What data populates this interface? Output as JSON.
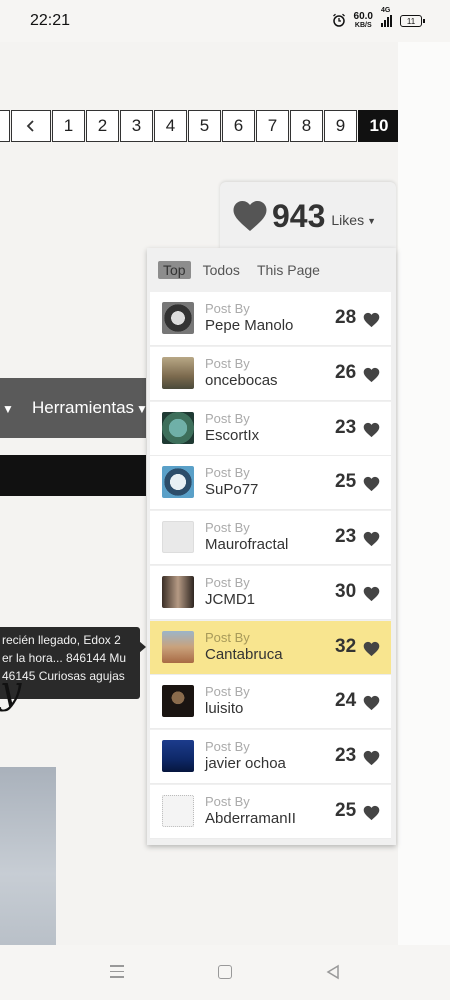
{
  "status_bar": {
    "time": "22:21",
    "net_speed": "60.0",
    "net_unit": "KB/S",
    "network": "4G",
    "battery": "11",
    "icons": [
      "alarm-icon",
      "signal-icon",
      "battery-icon"
    ]
  },
  "pagination": {
    "prev_icon": "chevron-left-icon",
    "pages": [
      "1",
      "2",
      "3",
      "4",
      "5",
      "6",
      "7",
      "8",
      "9",
      "10"
    ],
    "current": "10"
  },
  "menu": {
    "label": "Herramientas"
  },
  "tooltip": {
    "lines": [
      "recién llegado, Edox 2",
      "er la hora... 846144 Mu",
      "46145 Curiosas agujas"
    ]
  },
  "script_fragment": "y",
  "likes": {
    "count": "943",
    "label": "Likes",
    "tabs": [
      "Top",
      "Todos",
      "This Page"
    ],
    "active_tab": "Top",
    "post_by_label": "Post By",
    "entries": [
      {
        "author": "Pepe Manolo",
        "count": "28",
        "avatar": "watch-avatar"
      },
      {
        "author": "oncebocas",
        "count": "26",
        "avatar": "building-avatar"
      },
      {
        "author": "EscortIx",
        "count": "23",
        "avatar": "globe-avatar"
      },
      {
        "author": "SuPo77",
        "count": "25",
        "avatar": "watch-dial-avatar"
      },
      {
        "author": "Maurofractal",
        "count": "23",
        "avatar": "default-avatar"
      },
      {
        "author": "JCMD1",
        "count": "30",
        "avatar": "portrait-avatar"
      },
      {
        "author": "Cantabruca",
        "count": "32",
        "avatar": "landscape-avatar",
        "highlight": true
      },
      {
        "author": "luisito",
        "count": "24",
        "avatar": "dark-avatar"
      },
      {
        "author": "javier ochoa",
        "count": "23",
        "avatar": "blue-avatar"
      },
      {
        "author": "AbderramanII",
        "count": "25",
        "avatar": "sketch-avatar"
      }
    ]
  },
  "colors": {
    "highlight": "#f8e58f",
    "active_page": "#111111",
    "heart": "#555555"
  }
}
